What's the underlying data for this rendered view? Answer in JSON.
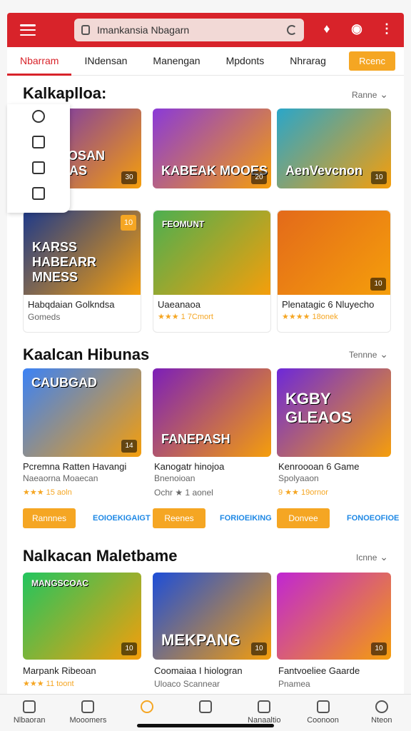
{
  "search": {
    "text": "Imankansia Nbagarn"
  },
  "tabs": [
    {
      "label": "Nbarram"
    },
    {
      "label": "INdensan"
    },
    {
      "label": "Manengan"
    },
    {
      "label": "Mpdonts"
    },
    {
      "label": "Nhrarag"
    }
  ],
  "tab_button": "Rcenc",
  "sections": [
    {
      "title": "Kalkaplloa:",
      "more": "Ranne"
    },
    {
      "title": "Kaalcan Hibunas",
      "more": "Tennne"
    },
    {
      "title": "Nalkacan Maletbame",
      "more": "Icnne"
    }
  ],
  "row1": [
    {
      "label": "TMENOSAN DOADAS",
      "corner": "30",
      "bg": "#6a2bbf"
    },
    {
      "label": "KABEAK MOOES",
      "corner": "20",
      "bg": "#8a3ad8"
    },
    {
      "label": "AenVevcnon",
      "corner": "10",
      "bg": "#2aa6c9"
    }
  ],
  "row2": [
    {
      "label": "KARSS HABEARR MNESS",
      "title": "Habqdaian Golkndsa",
      "sub": "Gomeds",
      "corner": "10",
      "bg": "#1e3a8a"
    },
    {
      "label": "FEOMUNT",
      "title": "Uaeanaoa",
      "sub": "★★★ 1 7Cmort",
      "corner": "",
      "bg": "#4caf50"
    },
    {
      "label": "",
      "title": "Plenatagic 6 Nluyecho",
      "sub": "★★★★ 18onek",
      "corner": "10",
      "bg": "#e36a1a"
    }
  ],
  "row3": [
    {
      "label": "CAUBGAD",
      "title": "Pcremna Ratten Havangi",
      "sub2": "Naeaorna Moaecan",
      "sub": "★★★ 15 aoln",
      "corner": "14",
      "bg": "#3b82f6",
      "btn": "Rannnes",
      "link": "EOIOEKIGAIGT"
    },
    {
      "label": "FANEPASH",
      "title": "Kanogatr hinojoa",
      "sub2": "Bnenoioan",
      "sub": "Ochr ★ 1 aonel",
      "corner": "",
      "bg": "#7c1fb8",
      "btn": "Reenes",
      "link": "FORIOEIKING"
    },
    {
      "label": "KGBY GLEAOS",
      "title": "Kenroooan 6 Game",
      "sub2": "Spolyaaon",
      "sub": "9 ★★ 19ornor",
      "corner": "",
      "bg": "#6d28d9",
      "btn": "Donvee",
      "link": "FONOEOFIOE"
    }
  ],
  "row4": [
    {
      "label": "MANGSCOAC",
      "title": "Marpank Ribeoan",
      "sub": "★★★ 11 toont",
      "corner": "10",
      "bg": "#22c55e"
    },
    {
      "label": "MEKPANG",
      "title": "Coomaiaa I hiologran",
      "sub": "Uloaco Scannear",
      "corner": "10",
      "bg": "#1d4ed8"
    },
    {
      "label": "",
      "title": "Fantvoeliee Gaarde",
      "sub": "Pnamea",
      "corner": "10",
      "bg": "#c026d3"
    }
  ],
  "bottom_nav": [
    {
      "label": "Nlbaoran"
    },
    {
      "label": "Mooomers"
    },
    {
      "label": ""
    },
    {
      "label": ""
    },
    {
      "label": "Nanaaltio"
    },
    {
      "label": "Coonoon"
    },
    {
      "label": "Nteon"
    }
  ]
}
